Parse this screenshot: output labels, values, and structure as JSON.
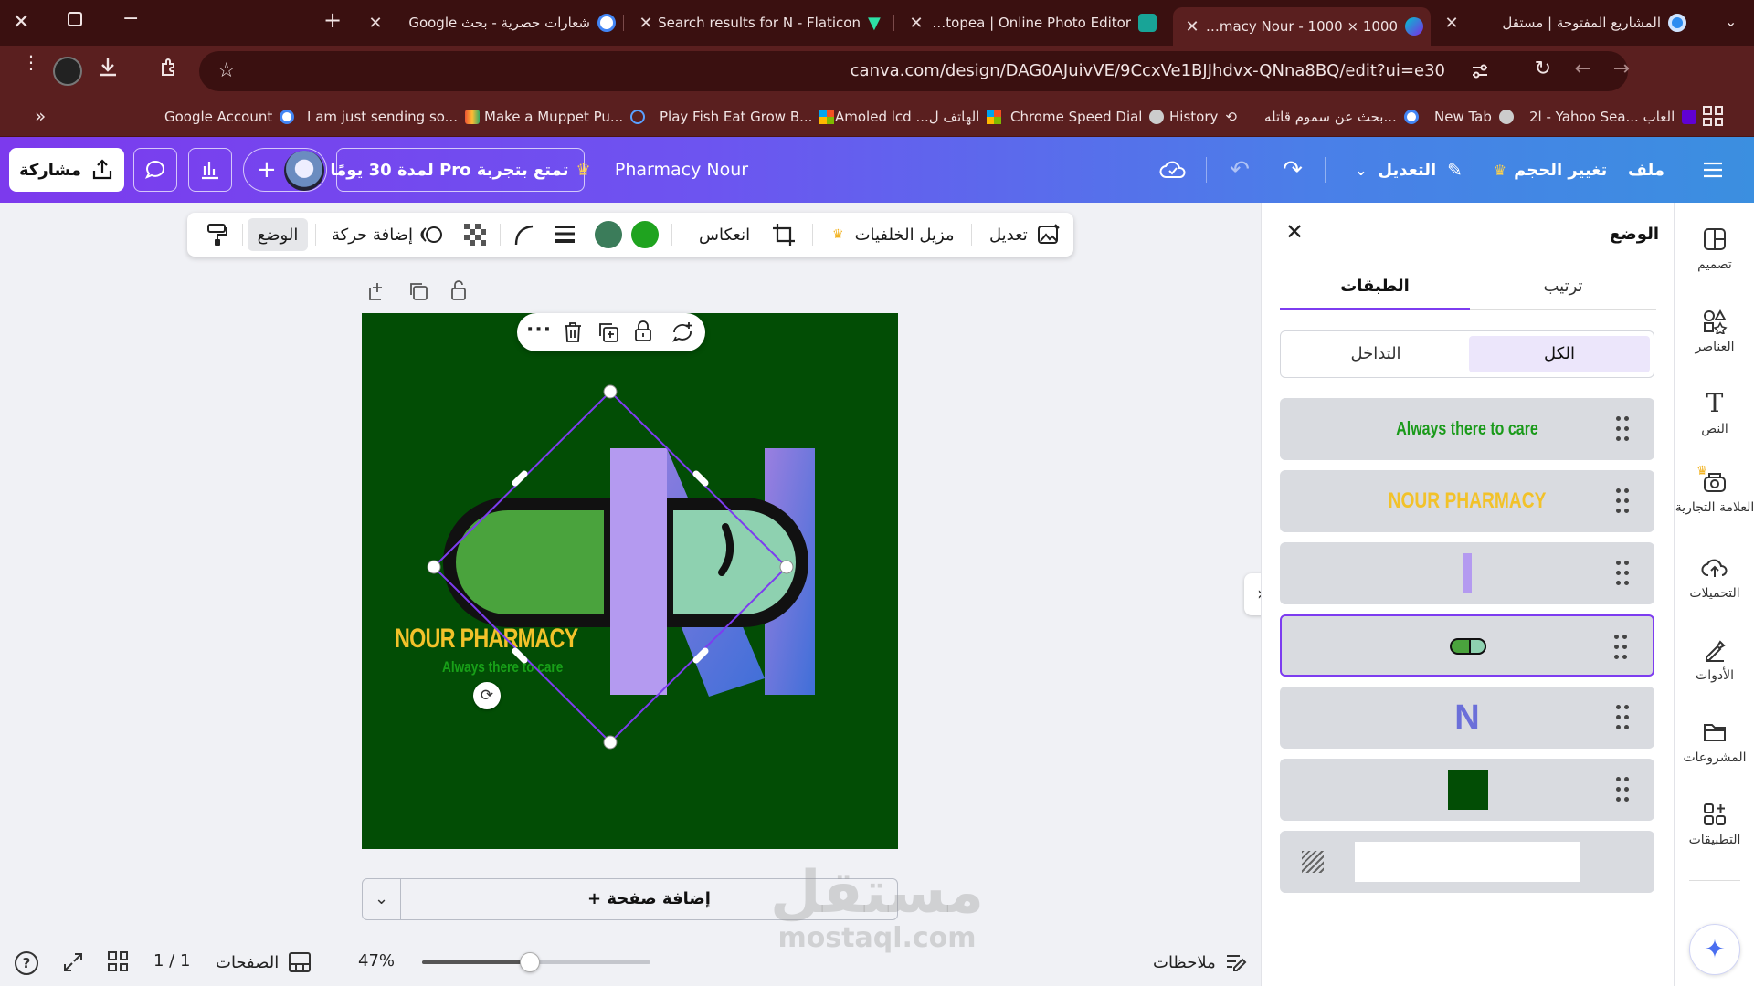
{
  "browser": {
    "tabs": [
      {
        "title": "المشاريع المفتوحة | مستقل",
        "active": false
      },
      {
        "title": "Pharmacy Nour - 1000 × 1000 ...",
        "active": true
      },
      {
        "title": "Photopea | Online Photo Editor",
        "active": false
      },
      {
        "title": "Search results for N - Flaticon",
        "active": false
      },
      {
        "title": "شعارات حصرية - بحث Google",
        "active": false
      }
    ],
    "url": "canva.com/design/DAG0AJuivVE/9CcxVe1BJJhdvx-QNna8BQ/edit?ui=e30",
    "bookmarks": [
      "Google Account",
      "I am just sending so...",
      "Make a Muppet Pu...",
      "Play Fish Eat Grow B...",
      "Amoled lcd ...الهاتف ل",
      "Chrome Speed Dial",
      "History",
      "بحث عن سموم قاتله...",
      "New Tab",
      "2l - Yahoo Sea... العاب"
    ]
  },
  "header": {
    "menu_file": "ملف",
    "resize": "تغيير الحجم",
    "edit": "التعديل",
    "doc_title": "Pharmacy Nour",
    "pro_trial": "تمتع بتجربة Pro لمدة 30 يومًا",
    "share": "مشاركة"
  },
  "toolbar": {
    "edit": "تعديل",
    "bg_remover": "مزيل الخلفيات",
    "flip": "انعكاس",
    "animate": "إضافة حركة",
    "position": "الوضع",
    "colors": [
      "#1fa31f",
      "#3b7c5a"
    ]
  },
  "canvas": {
    "bg_color": "#024d05",
    "title_text": "NOUR PHARMACY",
    "tagline": "Always there to care",
    "add_page": "+ إضافة صفحة"
  },
  "footer": {
    "notes": "ملاحظات",
    "zoom": "47%",
    "pages_label": "الصفحات",
    "page_count": "1 / 1",
    "watermark_ar": "مستقل",
    "watermark_en": "mostaql.com"
  },
  "panel": {
    "title": "الوضع",
    "tab_layers": "الطبقات",
    "tab_arrange": "ترتيب",
    "filter_all": "الكل",
    "filter_overlap": "التداخل",
    "layers": [
      {
        "kind": "text",
        "text": "Always there to care",
        "color": "#1a9a1a"
      },
      {
        "kind": "text",
        "text": "NOUR PHARMACY",
        "color": "#f2c22a"
      },
      {
        "kind": "bar",
        "color": "#b49af0"
      },
      {
        "kind": "pill",
        "selected": true
      },
      {
        "kind": "letter",
        "text": "N",
        "color": "#6b6fd9"
      },
      {
        "kind": "square",
        "color": "#024d05"
      },
      {
        "kind": "background",
        "color": "#ffffff"
      }
    ]
  },
  "rail": [
    {
      "label": "تصميم",
      "icon": "design-icon"
    },
    {
      "label": "العناصر",
      "icon": "elements-icon"
    },
    {
      "label": "النص",
      "icon": "text-icon"
    },
    {
      "label": "العلامة التجارية",
      "icon": "brand-icon"
    },
    {
      "label": "التحميلات",
      "icon": "upload-icon"
    },
    {
      "label": "الأدوات",
      "icon": "tools-icon"
    },
    {
      "label": "المشروعات",
      "icon": "projects-icon"
    },
    {
      "label": "التطبيقات",
      "icon": "apps-icon"
    }
  ]
}
